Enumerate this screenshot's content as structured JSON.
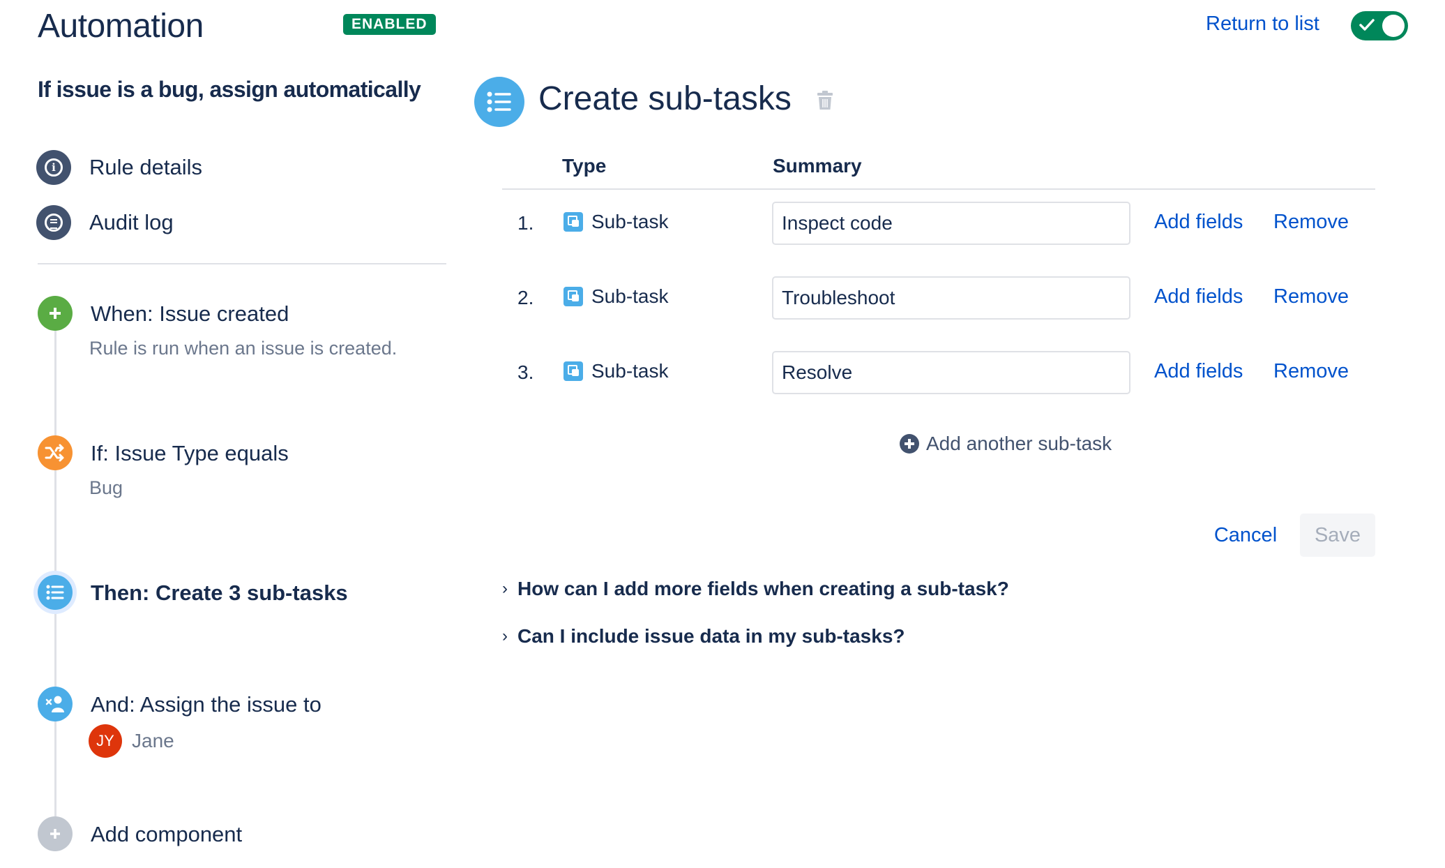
{
  "header": {
    "app_title": "Automation",
    "status_badge": "ENABLED",
    "return_link": "Return to list",
    "toggle_enabled": true
  },
  "sidebar": {
    "rule_name": "If issue is a bug, assign automatically",
    "nav": [
      {
        "label": "Rule details",
        "icon": "info-icon"
      },
      {
        "label": "Audit log",
        "icon": "list-icon"
      }
    ],
    "steps": [
      {
        "title": "When: Issue created",
        "desc": "Rule is run when an issue is created.",
        "icon": "plus-icon",
        "color": "#5aac44"
      },
      {
        "title": "If: Issue Type equals",
        "desc": "Bug",
        "icon": "shuffle-icon",
        "color": "#f79232"
      },
      {
        "title": "Then: Create 3 sub-tasks",
        "desc": "",
        "icon": "list-icon",
        "color": "#4bade8"
      },
      {
        "title": "And: Assign the issue to",
        "desc": "",
        "icon": "assign-user-icon",
        "color": "#4bade8"
      },
      {
        "title": "Add component",
        "desc": "",
        "icon": "plus-icon",
        "color": "#c1c7d0"
      }
    ],
    "assignee": {
      "initials": "JY",
      "name": "Jane"
    }
  },
  "panel": {
    "title": "Create sub-tasks",
    "columns": {
      "type": "Type",
      "summary": "Summary"
    },
    "rows": [
      {
        "num": "1.",
        "type": "Sub-task",
        "summary": "Inspect code"
      },
      {
        "num": "2.",
        "type": "Sub-task",
        "summary": "Troubleshoot"
      },
      {
        "num": "3.",
        "type": "Sub-task",
        "summary": "Resolve"
      }
    ],
    "add_fields_label": "Add fields",
    "remove_label": "Remove",
    "add_another_label": "Add another sub-task",
    "cancel_label": "Cancel",
    "save_label": "Save",
    "faqs": [
      "How can I add more fields when creating a sub-task?",
      "Can I include issue data in my sub-tasks?"
    ]
  }
}
